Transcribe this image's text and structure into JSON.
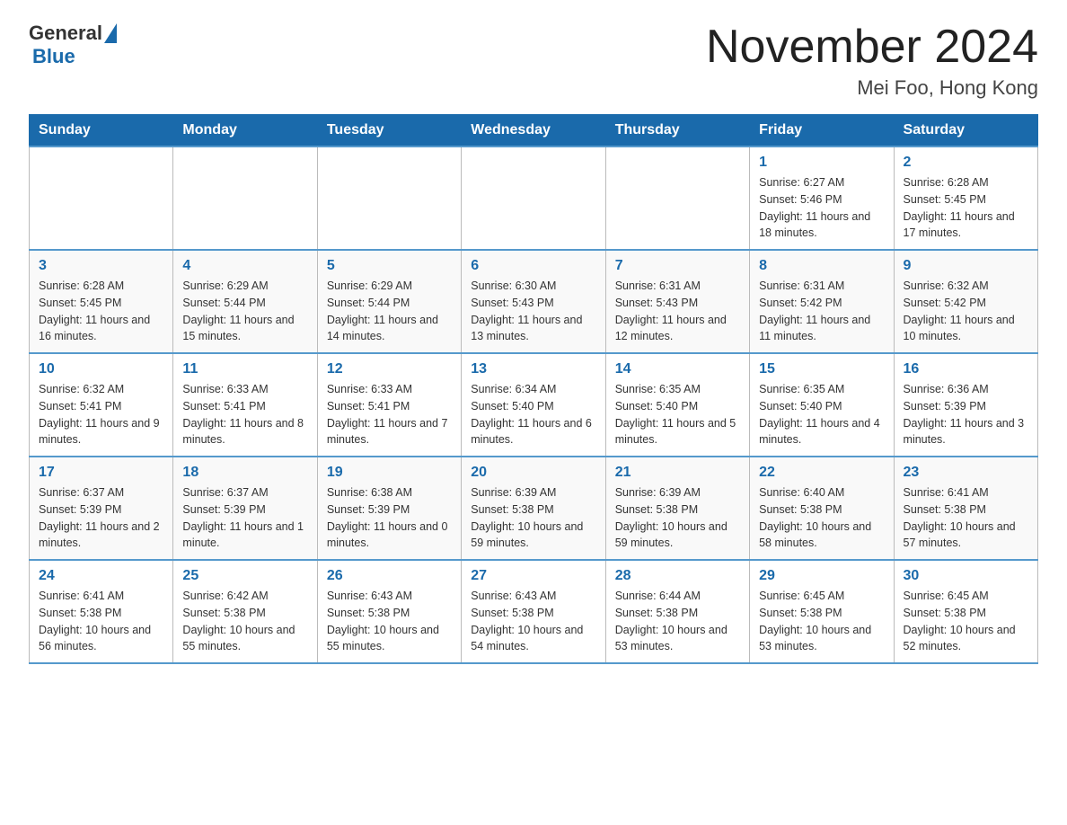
{
  "header": {
    "logo_general": "General",
    "logo_blue": "Blue",
    "month_title": "November 2024",
    "location": "Mei Foo, Hong Kong"
  },
  "weekdays": [
    "Sunday",
    "Monday",
    "Tuesday",
    "Wednesday",
    "Thursday",
    "Friday",
    "Saturday"
  ],
  "rows": [
    [
      {
        "day": "",
        "info": ""
      },
      {
        "day": "",
        "info": ""
      },
      {
        "day": "",
        "info": ""
      },
      {
        "day": "",
        "info": ""
      },
      {
        "day": "",
        "info": ""
      },
      {
        "day": "1",
        "info": "Sunrise: 6:27 AM\nSunset: 5:46 PM\nDaylight: 11 hours and 18 minutes."
      },
      {
        "day": "2",
        "info": "Sunrise: 6:28 AM\nSunset: 5:45 PM\nDaylight: 11 hours and 17 minutes."
      }
    ],
    [
      {
        "day": "3",
        "info": "Sunrise: 6:28 AM\nSunset: 5:45 PM\nDaylight: 11 hours and 16 minutes."
      },
      {
        "day": "4",
        "info": "Sunrise: 6:29 AM\nSunset: 5:44 PM\nDaylight: 11 hours and 15 minutes."
      },
      {
        "day": "5",
        "info": "Sunrise: 6:29 AM\nSunset: 5:44 PM\nDaylight: 11 hours and 14 minutes."
      },
      {
        "day": "6",
        "info": "Sunrise: 6:30 AM\nSunset: 5:43 PM\nDaylight: 11 hours and 13 minutes."
      },
      {
        "day": "7",
        "info": "Sunrise: 6:31 AM\nSunset: 5:43 PM\nDaylight: 11 hours and 12 minutes."
      },
      {
        "day": "8",
        "info": "Sunrise: 6:31 AM\nSunset: 5:42 PM\nDaylight: 11 hours and 11 minutes."
      },
      {
        "day": "9",
        "info": "Sunrise: 6:32 AM\nSunset: 5:42 PM\nDaylight: 11 hours and 10 minutes."
      }
    ],
    [
      {
        "day": "10",
        "info": "Sunrise: 6:32 AM\nSunset: 5:41 PM\nDaylight: 11 hours and 9 minutes."
      },
      {
        "day": "11",
        "info": "Sunrise: 6:33 AM\nSunset: 5:41 PM\nDaylight: 11 hours and 8 minutes."
      },
      {
        "day": "12",
        "info": "Sunrise: 6:33 AM\nSunset: 5:41 PM\nDaylight: 11 hours and 7 minutes."
      },
      {
        "day": "13",
        "info": "Sunrise: 6:34 AM\nSunset: 5:40 PM\nDaylight: 11 hours and 6 minutes."
      },
      {
        "day": "14",
        "info": "Sunrise: 6:35 AM\nSunset: 5:40 PM\nDaylight: 11 hours and 5 minutes."
      },
      {
        "day": "15",
        "info": "Sunrise: 6:35 AM\nSunset: 5:40 PM\nDaylight: 11 hours and 4 minutes."
      },
      {
        "day": "16",
        "info": "Sunrise: 6:36 AM\nSunset: 5:39 PM\nDaylight: 11 hours and 3 minutes."
      }
    ],
    [
      {
        "day": "17",
        "info": "Sunrise: 6:37 AM\nSunset: 5:39 PM\nDaylight: 11 hours and 2 minutes."
      },
      {
        "day": "18",
        "info": "Sunrise: 6:37 AM\nSunset: 5:39 PM\nDaylight: 11 hours and 1 minute."
      },
      {
        "day": "19",
        "info": "Sunrise: 6:38 AM\nSunset: 5:39 PM\nDaylight: 11 hours and 0 minutes."
      },
      {
        "day": "20",
        "info": "Sunrise: 6:39 AM\nSunset: 5:38 PM\nDaylight: 10 hours and 59 minutes."
      },
      {
        "day": "21",
        "info": "Sunrise: 6:39 AM\nSunset: 5:38 PM\nDaylight: 10 hours and 59 minutes."
      },
      {
        "day": "22",
        "info": "Sunrise: 6:40 AM\nSunset: 5:38 PM\nDaylight: 10 hours and 58 minutes."
      },
      {
        "day": "23",
        "info": "Sunrise: 6:41 AM\nSunset: 5:38 PM\nDaylight: 10 hours and 57 minutes."
      }
    ],
    [
      {
        "day": "24",
        "info": "Sunrise: 6:41 AM\nSunset: 5:38 PM\nDaylight: 10 hours and 56 minutes."
      },
      {
        "day": "25",
        "info": "Sunrise: 6:42 AM\nSunset: 5:38 PM\nDaylight: 10 hours and 55 minutes."
      },
      {
        "day": "26",
        "info": "Sunrise: 6:43 AM\nSunset: 5:38 PM\nDaylight: 10 hours and 55 minutes."
      },
      {
        "day": "27",
        "info": "Sunrise: 6:43 AM\nSunset: 5:38 PM\nDaylight: 10 hours and 54 minutes."
      },
      {
        "day": "28",
        "info": "Sunrise: 6:44 AM\nSunset: 5:38 PM\nDaylight: 10 hours and 53 minutes."
      },
      {
        "day": "29",
        "info": "Sunrise: 6:45 AM\nSunset: 5:38 PM\nDaylight: 10 hours and 53 minutes."
      },
      {
        "day": "30",
        "info": "Sunrise: 6:45 AM\nSunset: 5:38 PM\nDaylight: 10 hours and 52 minutes."
      }
    ]
  ]
}
